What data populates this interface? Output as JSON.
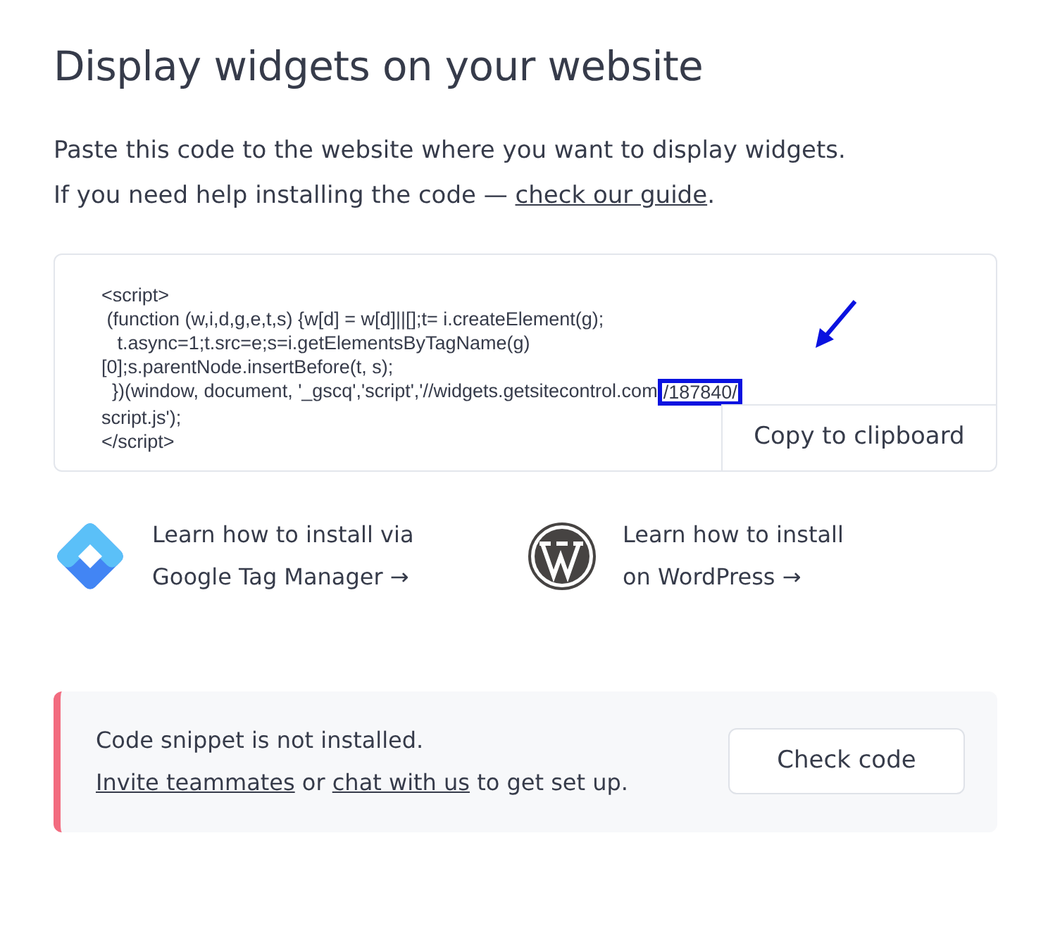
{
  "title": "Display widgets on your website",
  "intro": {
    "line_1": "Paste this code to the website where you want to display widgets.",
    "line_2": "If you need help installing the code — ",
    "link": "check our guide",
    "end": "."
  },
  "code_lines": [
    {
      "text": "<script>"
    },
    {
      "text": " (function (w,i,d,g,e,t,s) {w[d] = w[d]||[];t= i.createElement(g);"
    },
    {
      "text": "   t.async=1;t.src=e;s=i.getElementsByTagName(g)"
    },
    {
      "text": "[0];s.parentNode.insertBefore(t, s);"
    },
    {
      "text": "  })(window, document, '_gscq','script','//widgets.getsitecontrol.com",
      "highlight": "/187840/"
    },
    {
      "text": "script.js');"
    },
    {
      "text": "</script>"
    }
  ],
  "copy_button": "Copy to clipboard",
  "guides": [
    {
      "kind": "gtm",
      "line_1": "Learn how to install via",
      "line_2": "Google Tag Manager →"
    },
    {
      "kind": "wordpress",
      "line_1": "Learn how to install",
      "line_2": "on WordPress →"
    }
  ],
  "alert": {
    "message": "Code snippet is not installed.",
    "link_1": "Invite teammates",
    "middle": " or ",
    "link_2": "chat with us",
    "end": " to get set up.",
    "button": "Check code"
  }
}
